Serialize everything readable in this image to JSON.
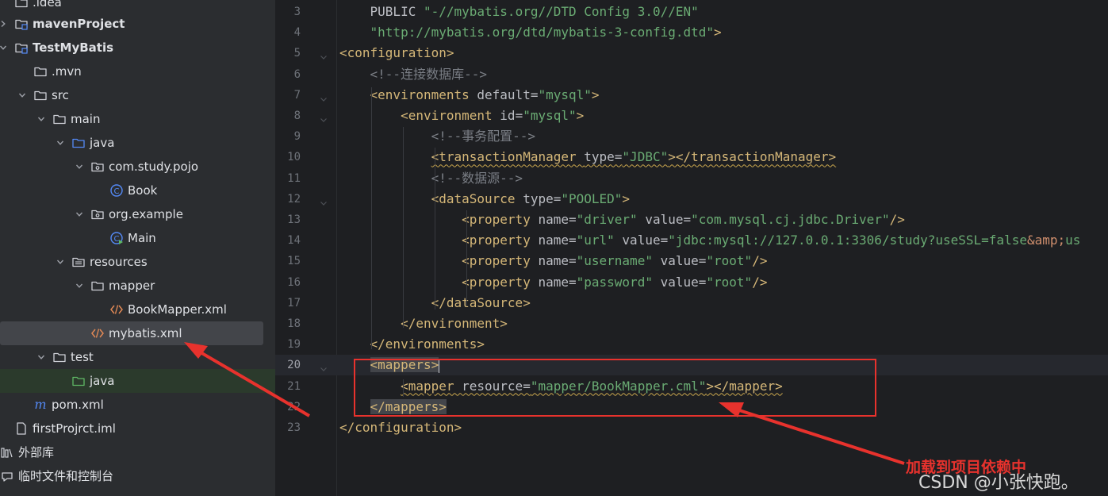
{
  "project_tree": {
    "items": [
      {
        "label": ".idea",
        "icon": "folder-icon"
      },
      {
        "label": "mavenProject",
        "icon": "module-folder-icon"
      },
      {
        "label": "TestMyBatis",
        "icon": "module-folder-icon"
      },
      {
        "label": ".mvn",
        "icon": "folder-icon"
      },
      {
        "label": "src",
        "icon": "folder-icon"
      },
      {
        "label": "main",
        "icon": "folder-icon"
      },
      {
        "label": "java",
        "icon": "source-folder-icon"
      },
      {
        "label": "com.study.pojo",
        "icon": "package-icon"
      },
      {
        "label": "Book",
        "icon": "class-icon"
      },
      {
        "label": "org.example",
        "icon": "package-icon"
      },
      {
        "label": "Main",
        "icon": "main-class-icon"
      },
      {
        "label": "resources",
        "icon": "resources-folder-icon"
      },
      {
        "label": "mapper",
        "icon": "folder-icon"
      },
      {
        "label": "BookMapper.xml",
        "icon": "xml-file-icon"
      },
      {
        "label": "mybatis.xml",
        "icon": "xml-file-icon"
      },
      {
        "label": "test",
        "icon": "folder-icon"
      },
      {
        "label": "java",
        "icon": "test-source-folder-icon"
      },
      {
        "label": "pom.xml",
        "icon": "maven-icon"
      },
      {
        "label": "firstProjrct.iml",
        "icon": "iml-file-icon"
      },
      {
        "label": "外部库",
        "icon": "library-icon"
      },
      {
        "label": "临时文件和控制台",
        "icon": "scratch-icon"
      }
    ]
  },
  "editor": {
    "current_line": "20",
    "lines": [
      {
        "n": "3",
        "parts": [
          [
            "plain",
            "    PUBLIC "
          ],
          [
            "val",
            "\"-//mybatis.org//DTD Config 3.0//EN\""
          ]
        ]
      },
      {
        "n": "4",
        "parts": [
          [
            "val",
            "    \"http://mybatis.org/dtd/mybatis-3-config.dtd\""
          ],
          [
            "tag",
            ">"
          ]
        ]
      },
      {
        "n": "5",
        "parts": [
          [
            "tag",
            "<configuration>"
          ]
        ]
      },
      {
        "n": "6",
        "parts": [
          [
            "plain",
            "    "
          ],
          [
            "cm",
            "<!--连接数据库-->"
          ]
        ]
      },
      {
        "n": "7",
        "parts": [
          [
            "plain",
            "    "
          ],
          [
            "tag",
            "<environments "
          ],
          [
            "attr",
            "default="
          ],
          [
            "val",
            "\"mysql\""
          ],
          [
            "tag",
            ">"
          ]
        ]
      },
      {
        "n": "8",
        "parts": [
          [
            "plain",
            "        "
          ],
          [
            "tag",
            "<environment "
          ],
          [
            "attr",
            "id="
          ],
          [
            "val",
            "\"mysql\""
          ],
          [
            "tag",
            ">"
          ]
        ]
      },
      {
        "n": "9",
        "parts": [
          [
            "plain",
            "            "
          ],
          [
            "cm",
            "<!--事务配置-->"
          ]
        ]
      },
      {
        "n": "10",
        "parts": [
          [
            "plain",
            "            "
          ],
          [
            "tagw",
            "<transactionManager "
          ],
          [
            "attrw",
            "type="
          ],
          [
            "valw",
            "\"JDBC\""
          ],
          [
            "tagw",
            "></transactionManager>"
          ]
        ]
      },
      {
        "n": "11",
        "parts": [
          [
            "plain",
            "            "
          ],
          [
            "cm",
            "<!--数据源-->"
          ]
        ]
      },
      {
        "n": "12",
        "parts": [
          [
            "plain",
            "            "
          ],
          [
            "tag",
            "<dataSource "
          ],
          [
            "attr",
            "type="
          ],
          [
            "val",
            "\"POOLED\""
          ],
          [
            "tag",
            ">"
          ]
        ]
      },
      {
        "n": "13",
        "parts": [
          [
            "plain",
            "                "
          ],
          [
            "tag",
            "<property "
          ],
          [
            "attr",
            "name="
          ],
          [
            "val",
            "\"driver\" "
          ],
          [
            "attr",
            "value="
          ],
          [
            "val",
            "\"com.mysql.cj.jdbc.Driver\""
          ],
          [
            "tag",
            "/>"
          ]
        ]
      },
      {
        "n": "14",
        "parts": [
          [
            "plain",
            "                "
          ],
          [
            "tag",
            "<property "
          ],
          [
            "attr",
            "name="
          ],
          [
            "val",
            "\"url\" "
          ],
          [
            "attr",
            "value="
          ],
          [
            "val",
            "\"jdbc:mysql://127.0.0.1:3306/study?useSSL=false"
          ],
          [
            "ent",
            "&amp;"
          ],
          [
            "val",
            "us"
          ]
        ]
      },
      {
        "n": "15",
        "parts": [
          [
            "plain",
            "                "
          ],
          [
            "tag",
            "<property "
          ],
          [
            "attr",
            "name="
          ],
          [
            "val",
            "\"username\" "
          ],
          [
            "attr",
            "value="
          ],
          [
            "val",
            "\"root\""
          ],
          [
            "tag",
            "/>"
          ]
        ]
      },
      {
        "n": "16",
        "parts": [
          [
            "plain",
            "                "
          ],
          [
            "tag",
            "<property "
          ],
          [
            "attr",
            "name="
          ],
          [
            "val",
            "\"password\" "
          ],
          [
            "attr",
            "value="
          ],
          [
            "val",
            "\"root\""
          ],
          [
            "tag",
            "/>"
          ]
        ]
      },
      {
        "n": "17",
        "parts": [
          [
            "plain",
            "            "
          ],
          [
            "tag",
            "</dataSource>"
          ]
        ]
      },
      {
        "n": "18",
        "parts": [
          [
            "plain",
            "        "
          ],
          [
            "tag",
            "</environment>"
          ]
        ]
      },
      {
        "n": "19",
        "parts": [
          [
            "plain",
            "    "
          ],
          [
            "tag",
            "</environments>"
          ]
        ]
      },
      {
        "n": "20",
        "parts": [
          [
            "plain",
            "    "
          ],
          [
            "tagh",
            "<mappers>"
          ],
          [
            "caret",
            ""
          ]
        ]
      },
      {
        "n": "21",
        "parts": [
          [
            "plain",
            "        "
          ],
          [
            "tagw",
            "<mapper "
          ],
          [
            "attrw",
            "resource="
          ],
          [
            "valw",
            "\"mapper/BookMapper.cml\""
          ],
          [
            "tagw",
            "></mapper>"
          ]
        ]
      },
      {
        "n": "22",
        "parts": [
          [
            "plain",
            "    "
          ],
          [
            "tagh",
            "</mappers>"
          ]
        ]
      },
      {
        "n": "23",
        "parts": [
          [
            "tag",
            "</configuration>"
          ]
        ]
      }
    ]
  },
  "annotation": {
    "text": "加载到项目依赖中",
    "color": "#e8322d"
  },
  "watermark": "CSDN @小张快跑。"
}
